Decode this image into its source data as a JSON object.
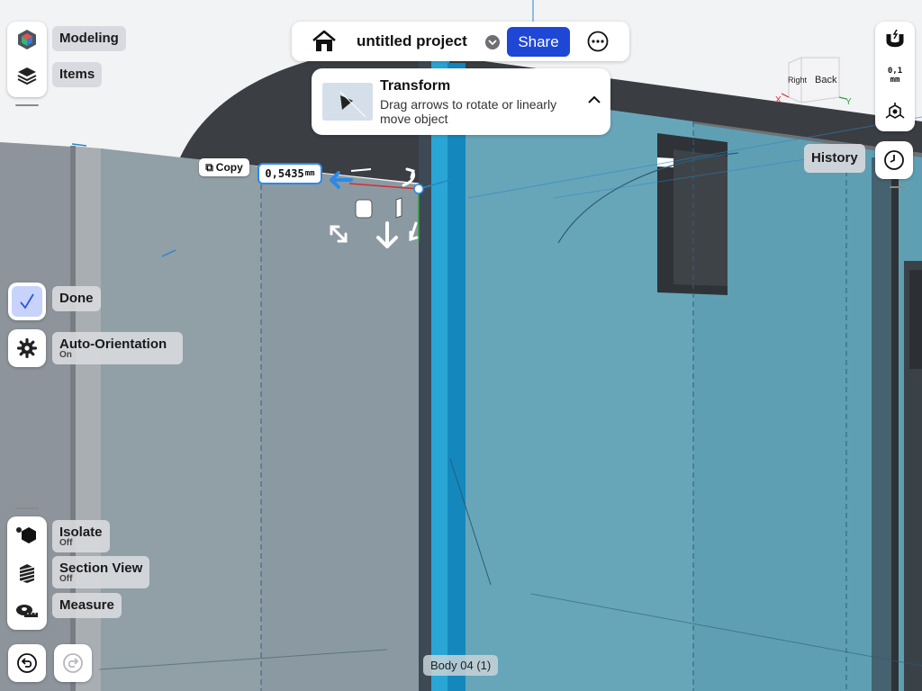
{
  "topbar": {
    "project_title": "untitled project",
    "share_label": "Share"
  },
  "transform_panel": {
    "title": "Transform",
    "description": "Drag arrows to rotate or linearly move object"
  },
  "left_top": {
    "modeling_label": "Modeling",
    "items_label": "Items"
  },
  "left_mid": {
    "done_label": "Done",
    "auto_orientation_label": "Auto-Orientation",
    "auto_orientation_state": "On"
  },
  "left_bottom": {
    "isolate_label": "Isolate",
    "isolate_state": "Off",
    "section_view_label": "Section View",
    "section_view_state": "Off",
    "measure_label": "Measure"
  },
  "right": {
    "snap_value": "0,1",
    "snap_unit": "mm",
    "history_label": "History"
  },
  "view_cube": {
    "face_right": "Right",
    "face_back": "Back",
    "axis_x": "X",
    "axis_y": "Y"
  },
  "gizmo": {
    "copy_label": "Copy",
    "dimension_value": "0,5435",
    "dimension_unit": "mm"
  },
  "selection": {
    "body_label": "Body 04 (1)"
  },
  "colors": {
    "accent": "#1f47d6",
    "glass": "#5f9fb3",
    "wall_gray": "#8d949b",
    "dimension_blue": "#2b8ae8"
  }
}
